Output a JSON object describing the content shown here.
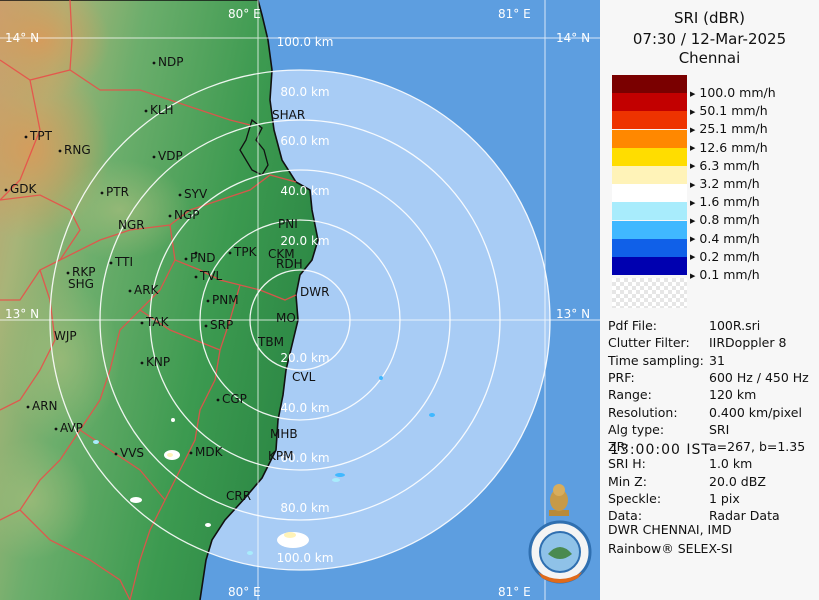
{
  "title": {
    "line1": "SRI (dBR)",
    "line2": "07:30 / 12-Mar-2025",
    "line3": "Chennai"
  },
  "legend": [
    {
      "label": "100.0 mm/h",
      "color": "#7a0000"
    },
    {
      "label": "50.1 mm/h",
      "color": "#c20000"
    },
    {
      "label": "25.1 mm/h",
      "color": "#ee3300"
    },
    {
      "label": "12.6 mm/h",
      "color": "#ff8800"
    },
    {
      "label": "6.3 mm/h",
      "color": "#ffdd00"
    },
    {
      "label": "3.2 mm/h",
      "color": "#fff3b8"
    },
    {
      "label": "1.6 mm/h",
      "color": "#ffffff"
    },
    {
      "label": "0.8 mm/h",
      "color": "#a8ecfc"
    },
    {
      "label": "0.4 mm/h",
      "color": "#40b8ff"
    },
    {
      "label": "0.2 mm/h",
      "color": "#1060e8"
    },
    {
      "label": "0.1 mm/h",
      "color": "#0000b0"
    }
  ],
  "info": [
    {
      "key": "Pdf File:",
      "value": "100R.sri"
    },
    {
      "key": "Clutter Filter:",
      "value": "IIRDoppler 8"
    },
    {
      "key": "Time sampling:",
      "value": "31"
    },
    {
      "key": "PRF:",
      "value": "600 Hz / 450 Hz"
    },
    {
      "key": "Range:",
      "value": "120 km"
    },
    {
      "key": "Resolution:",
      "value": "0.400 km/pixel"
    },
    {
      "key": "Alg type:",
      "value": "SRI"
    },
    {
      "key": "ZR:",
      "value": "a=267, b=1.35"
    },
    {
      "key": "SRI H:",
      "value": "1.0 km"
    },
    {
      "key": "Min Z:",
      "value": "20.0 dBZ"
    },
    {
      "key": "Speckle:",
      "value": "1 pix"
    },
    {
      "key": "Data:",
      "value": "Radar Data"
    }
  ],
  "footer": {
    "line1": "DWR CHENNAI, IMD",
    "line2": "Rainbow® SELEX-SI"
  },
  "time": "13:00:00  IST",
  "range_labels": [
    "20.0 km",
    "40.0 km",
    "60.0 km",
    "80.0 km",
    "100.0 km"
  ],
  "grid_labels": {
    "lon_80": "80° E",
    "lon_81": "81° E",
    "lat_14": "14° N",
    "lat_13": "13° N"
  },
  "stations": [
    {
      "name": "NDP"
    },
    {
      "name": "KLH"
    },
    {
      "name": "SHAR"
    },
    {
      "name": "TPT"
    },
    {
      "name": "RNG"
    },
    {
      "name": "VDP"
    },
    {
      "name": "GDK"
    },
    {
      "name": "PTR"
    },
    {
      "name": "SYV"
    },
    {
      "name": "NGR"
    },
    {
      "name": "NGP"
    },
    {
      "name": "PNI"
    },
    {
      "name": "TTI"
    },
    {
      "name": "PND"
    },
    {
      "name": "TPK"
    },
    {
      "name": "CKM"
    },
    {
      "name": "RDH"
    },
    {
      "name": "RKP"
    },
    {
      "name": "SHG"
    },
    {
      "name": "ARK"
    },
    {
      "name": "TVL"
    },
    {
      "name": "DWR"
    },
    {
      "name": "PNM"
    },
    {
      "name": "WJP"
    },
    {
      "name": "TAK"
    },
    {
      "name": "SRP"
    },
    {
      "name": "MO"
    },
    {
      "name": "TBM"
    },
    {
      "name": "KNP"
    },
    {
      "name": "CVL"
    },
    {
      "name": "ARN"
    },
    {
      "name": "CGP"
    },
    {
      "name": "AVP"
    },
    {
      "name": "MHB"
    },
    {
      "name": "VVS"
    },
    {
      "name": "MDK"
    },
    {
      "name": "KPM"
    },
    {
      "name": "CRR"
    }
  ]
}
